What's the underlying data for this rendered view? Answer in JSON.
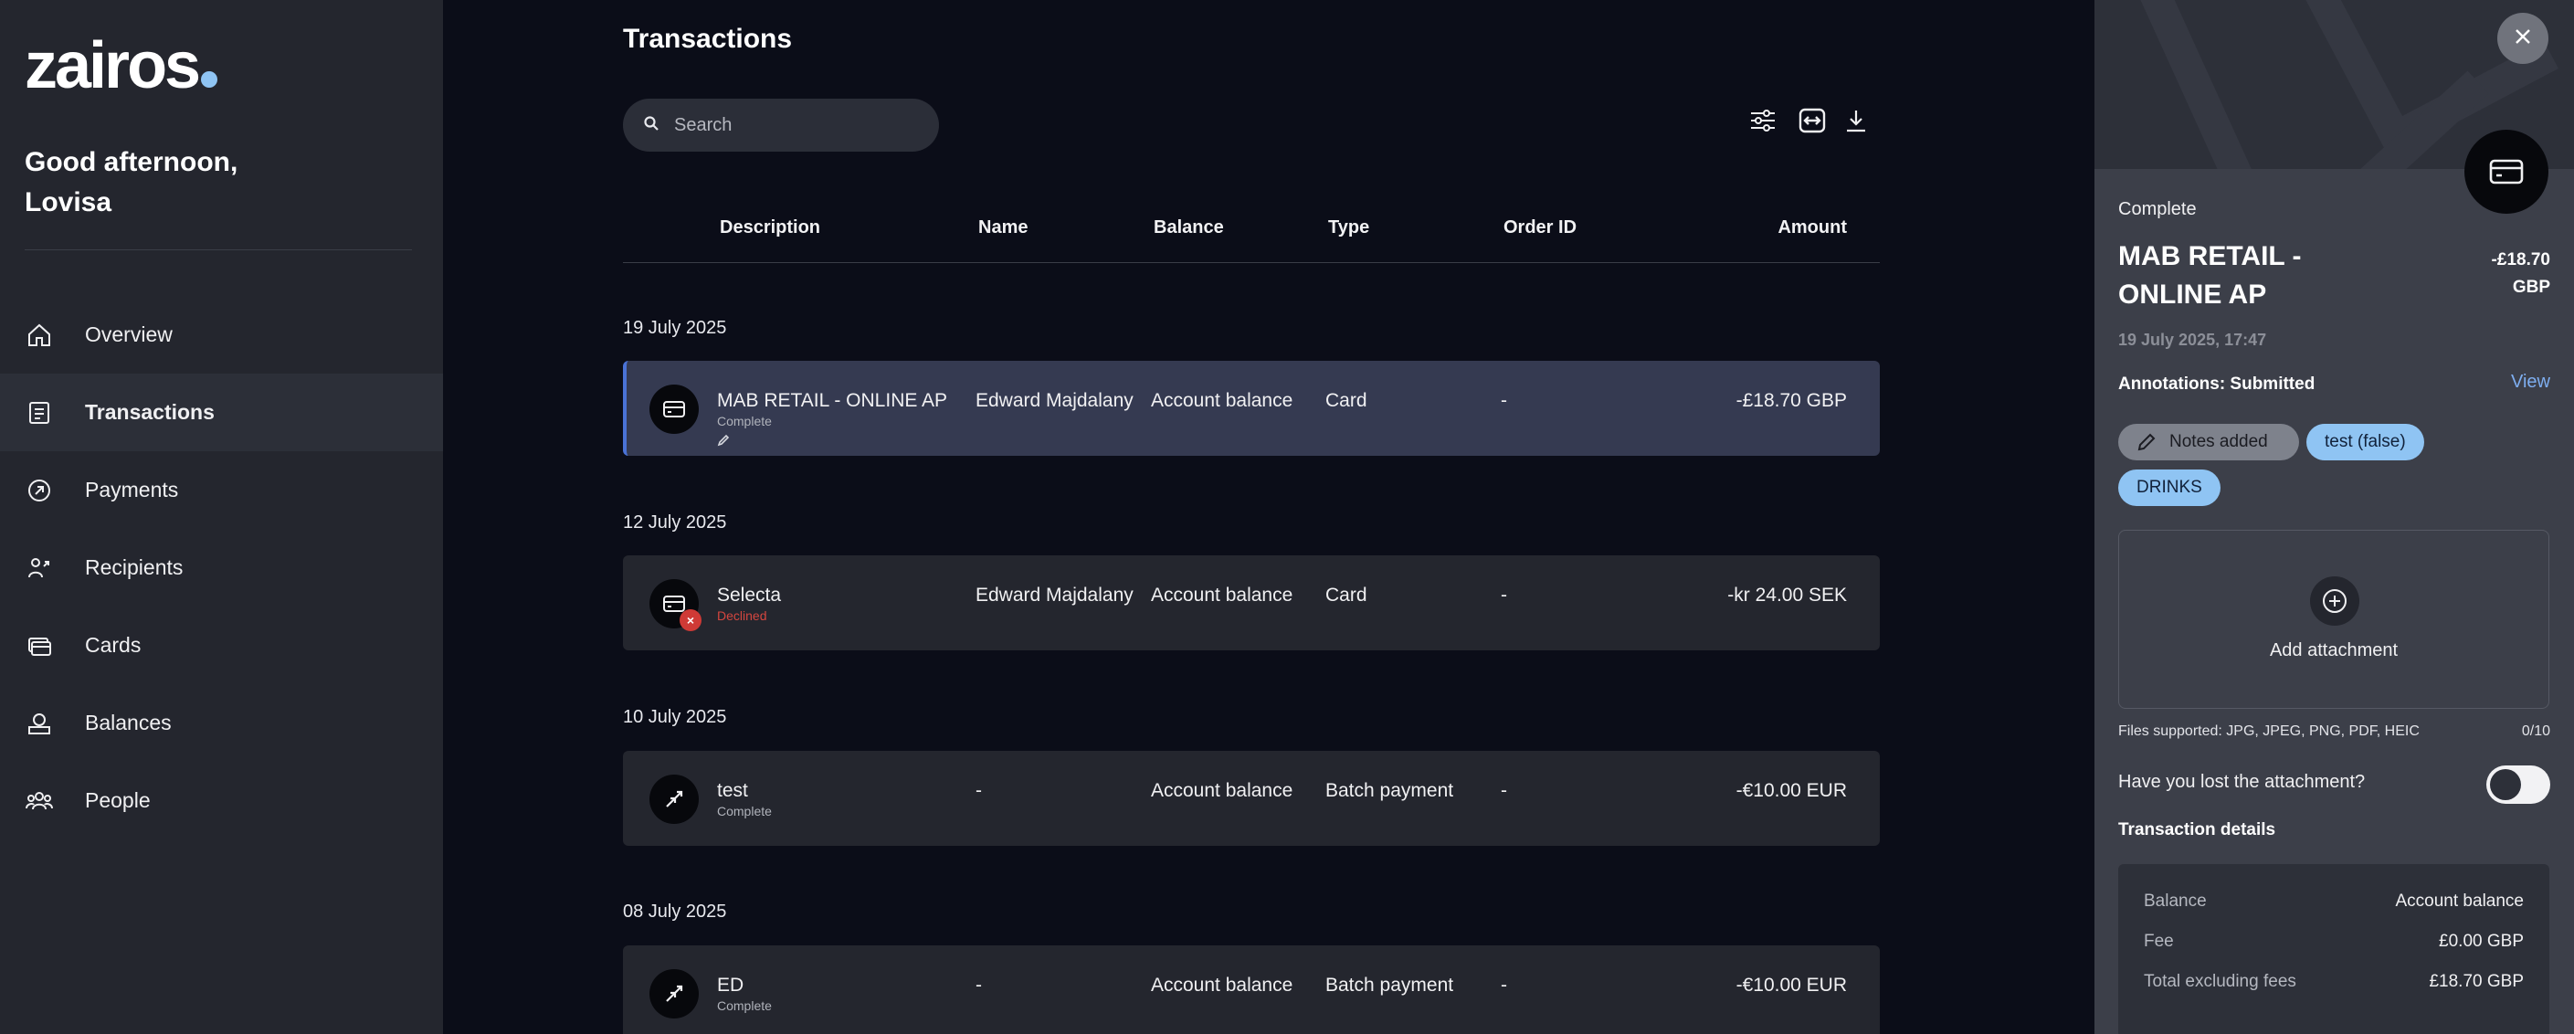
{
  "brand": {
    "logo_text": "zairos"
  },
  "greeting": {
    "line1": "Good afternoon,",
    "line2": "Lovisa"
  },
  "nav": [
    {
      "label": "Overview",
      "icon": "home-icon",
      "active": false
    },
    {
      "label": "Transactions",
      "icon": "list-icon",
      "active": true
    },
    {
      "label": "Payments",
      "icon": "payment-arrow-icon",
      "active": false
    },
    {
      "label": "Recipients",
      "icon": "recipients-icon",
      "active": false
    },
    {
      "label": "Cards",
      "icon": "cards-icon",
      "active": false
    },
    {
      "label": "Balances",
      "icon": "balances-icon",
      "active": false
    },
    {
      "label": "People",
      "icon": "people-icon",
      "active": false
    }
  ],
  "main": {
    "title": "Transactions",
    "search": {
      "placeholder": "Search",
      "value": ""
    },
    "toolbar": [
      "filter-icon",
      "expand-icon",
      "download-icon"
    ],
    "columns": {
      "description": "Description",
      "name": "Name",
      "balance": "Balance",
      "type": "Type",
      "order_id": "Order ID",
      "amount": "Amount"
    },
    "groups": [
      {
        "date": "19 July 2025",
        "tx": {
          "description": "MAB RETAIL - ONLINE AP",
          "status": "Complete",
          "name": "Edward Majdalany",
          "balance": "Account balance",
          "type": "Card",
          "order_id": "-",
          "amount": "-£18.70 GBP",
          "icon": "card-icon"
        }
      },
      {
        "date": "12 July 2025",
        "tx": {
          "description": "Selecta",
          "status": "Declined",
          "name": "Edward Majdalany",
          "balance": "Account balance",
          "type": "Card",
          "order_id": "-",
          "amount": "-kr 24.00 SEK",
          "icon": "card-icon"
        }
      },
      {
        "date": "10 July 2025",
        "tx": {
          "description": "test",
          "status": "Complete",
          "name": "-",
          "balance": "Account balance",
          "type": "Batch payment",
          "order_id": "-",
          "amount": "-€10.00 EUR",
          "icon": "outgoing-arrow-icon"
        }
      },
      {
        "date": "08 July 2025",
        "tx": {
          "description": "ED",
          "status": "Complete",
          "name": "-",
          "balance": "Account balance",
          "type": "Batch payment",
          "order_id": "-",
          "amount": "-€10.00 EUR",
          "icon": "outgoing-arrow-icon"
        }
      }
    ]
  },
  "panel": {
    "status": "Complete",
    "title": "MAB RETAIL - ONLINE AP",
    "amount_line1": "-£18.70",
    "amount_line2": "GBP",
    "date": "19 July 2025, 17:47",
    "annotations": "Annotations: Submitted",
    "view_label": "View",
    "chips": {
      "notes": "Notes added",
      "test": "test (false)",
      "drinks": "DRINKS"
    },
    "add_attachment": "Add attachment",
    "files_supported": "Files supported: JPG, JPEG, PNG, PDF, HEIC",
    "files_count": "0/10",
    "lost_attachment": "Have you lost the attachment?",
    "details_title": "Transaction details",
    "details": [
      {
        "key": "Balance",
        "value": "Account balance"
      },
      {
        "key": "Fee",
        "value": "£0.00 GBP"
      },
      {
        "key": "Total excluding fees",
        "value": "£18.70 GBP"
      }
    ]
  },
  "colors": {
    "accent": "#8fc4f3",
    "declined": "#d4463f",
    "link": "#7eaef0"
  }
}
